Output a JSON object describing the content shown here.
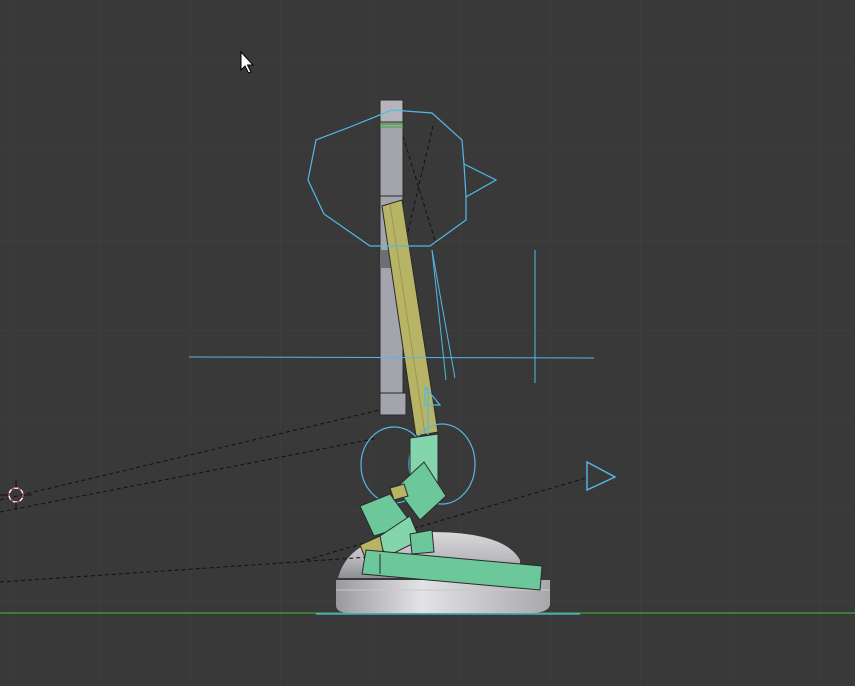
{
  "viewport": {
    "background": "#393939",
    "grid_color": "#414141",
    "horizon_line_color": "#3fa33f"
  },
  "colors": {
    "bone_gray": "#a4a4ac",
    "bone_gray_dark": "#6d6d74",
    "bone_yellow": "#b8b466",
    "bone_green": "#6cc79a",
    "bone_green_light": "#84d4ac",
    "widget_blue": "#52b9e8",
    "dashed_line": "#111111",
    "mesh_light": "#d9d9dc",
    "mesh_dark": "#8e8e92",
    "cursor_3d_red": "#e0484d"
  },
  "icons": {
    "mouse_pointer": "mouse-pointer-icon",
    "cursor_3d": "3d-cursor-icon",
    "ik_target": "ik-target-triangle-icon"
  }
}
